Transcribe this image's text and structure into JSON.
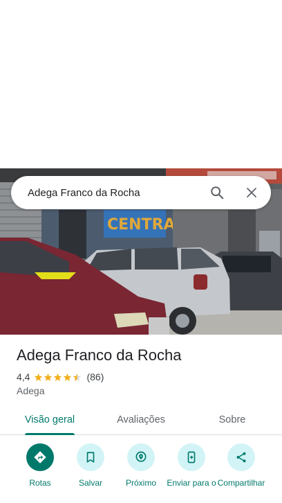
{
  "search": {
    "query": "Adega Franco da Rocha"
  },
  "place": {
    "name": "Adega Franco da Rocha",
    "rating": "4,4",
    "rating_value": 4.4,
    "reviews_count": "(86)",
    "category": "Adega"
  },
  "photo": {
    "storefront_sign": "CENTRAL"
  },
  "tabs": [
    {
      "label": "Visão geral",
      "active": true
    },
    {
      "label": "Avaliações",
      "active": false
    },
    {
      "label": "Sobre",
      "active": false
    }
  ],
  "actions": [
    {
      "label": "Rotas",
      "icon": "directions-icon",
      "primary": true
    },
    {
      "label": "Salvar",
      "icon": "bookmark-icon",
      "primary": false
    },
    {
      "label": "Próximo",
      "icon": "nearby-icon",
      "primary": false
    },
    {
      "label": "Enviar para o",
      "icon": "send-to-phone-icon",
      "primary": false
    },
    {
      "label": "Compartilhar",
      "icon": "share-icon",
      "primary": false
    }
  ],
  "colors": {
    "accent": "#00796b",
    "action_bg": "#d2f4f7",
    "star": "#f2b01e"
  }
}
